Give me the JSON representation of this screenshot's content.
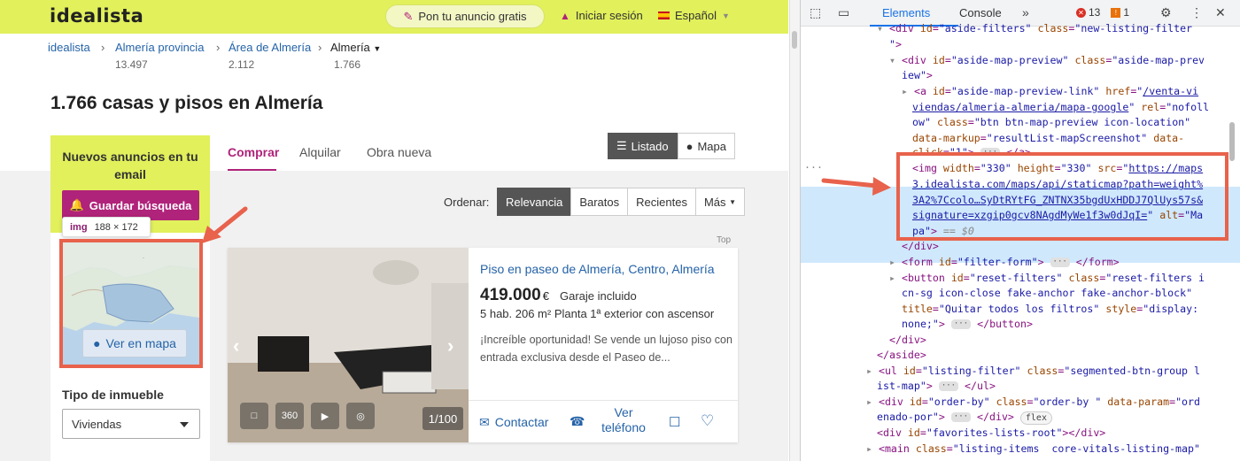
{
  "header": {
    "logo": "idealista",
    "publish_button": "Pon tu anuncio gratis",
    "login": "Iniciar sesión",
    "language": "Español"
  },
  "breadcrumb": [
    {
      "label": "idealista",
      "count": ""
    },
    {
      "label": "Almería provincia",
      "count": "13.497"
    },
    {
      "label": "Área de Almería",
      "count": "2.112"
    },
    {
      "label": "Almería",
      "count": "1.766"
    }
  ],
  "page_title": "1.766 casas y pisos en Almería",
  "sidebar": {
    "newsletter_title": "Nuevos anuncios en tu email",
    "save_search": "Guardar búsqueda",
    "tooltip_tag": "img",
    "tooltip_size": "188 × 172",
    "map_button": "Ver en mapa",
    "property_type_label": "Tipo de inmueble",
    "property_type_value": "Viviendas"
  },
  "tabs": [
    "Comprar",
    "Alquilar",
    "Obra nueva"
  ],
  "view_buttons": [
    "Listado",
    "Mapa"
  ],
  "order": {
    "label": "Ordenar:",
    "options": [
      "Relevancia",
      "Baratos",
      "Recientes",
      "Más"
    ]
  },
  "top_label": "Top",
  "listing": {
    "title": "Piso en paseo de Almería, Centro, Almería",
    "price": "419.000",
    "currency": "€",
    "garage": "Garaje incluido",
    "details": "5 hab.   206 m²   Planta 1ª exterior con ascensor",
    "description": "¡Increíble oportunidad! Se vende un lujoso piso con entrada exclusiva desde el Paseo de...",
    "photo_counter": "1/100",
    "photo_icon_360": "360",
    "contact": "Contactar",
    "view_phone": "Ver teléfono"
  },
  "devtools": {
    "tabs": [
      "Elements",
      "Console"
    ],
    "errors": "13",
    "warnings": "1"
  },
  "colors": {
    "brand_yellow": "#e1f05b",
    "brand_magenta": "#b0237a",
    "link_blue": "#2563a8",
    "annotation_red": "#e8624c"
  }
}
